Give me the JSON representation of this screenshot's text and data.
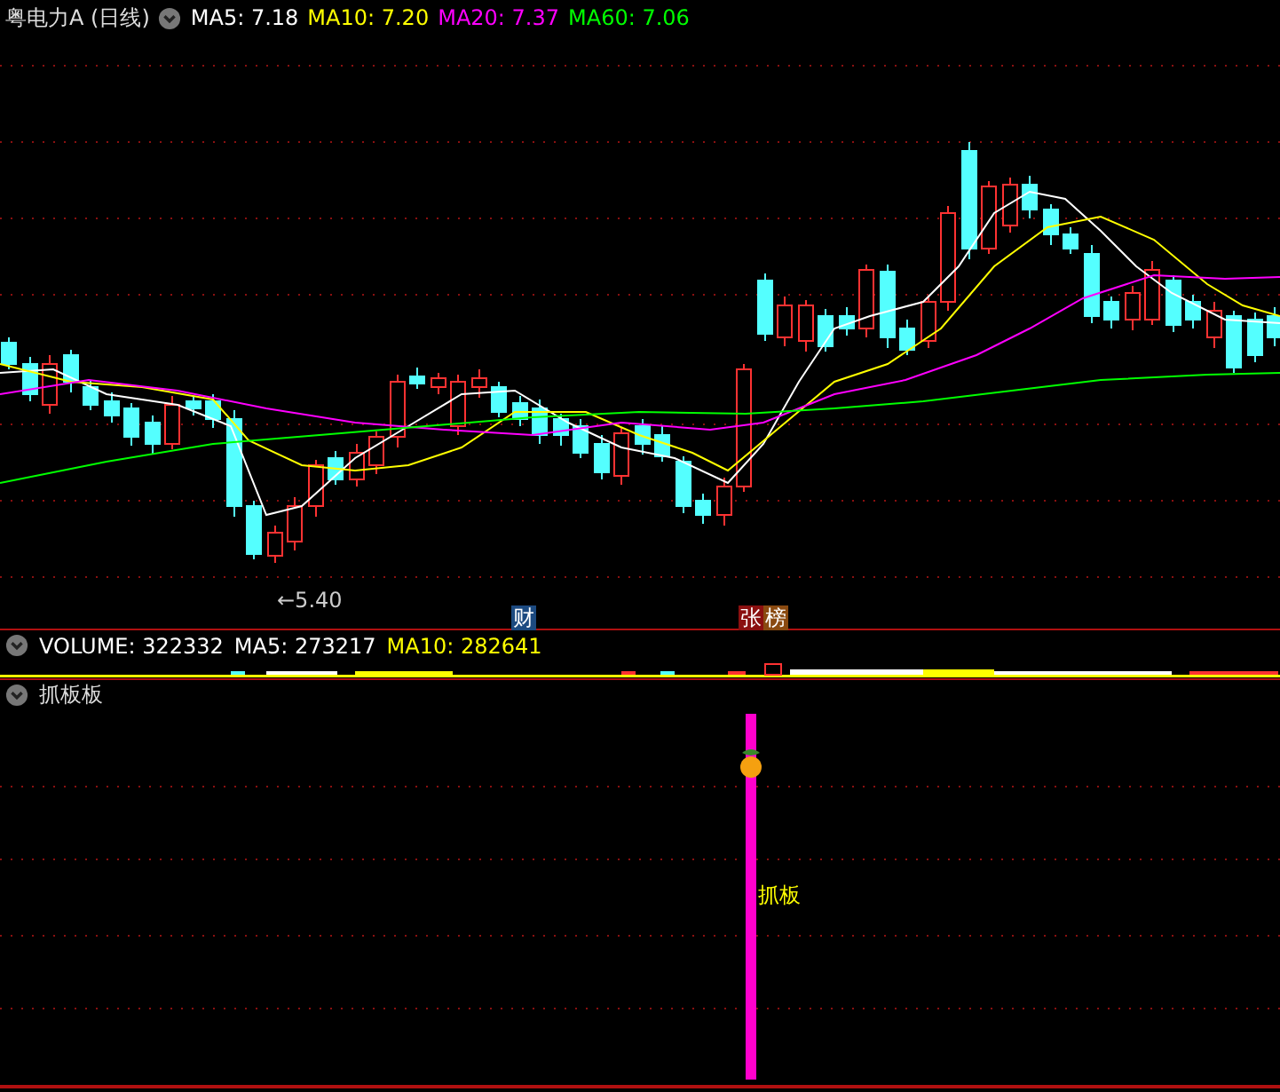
{
  "price_panel": {
    "title": "粤电力A (日线)",
    "indicators": [
      {
        "label": "MA5: 7.18",
        "color": "#ffffff"
      },
      {
        "label": "MA10: 7.20",
        "color": "#ffff00"
      },
      {
        "label": "MA20: 7.37",
        "color": "#ff00ff"
      },
      {
        "label": "MA60: 7.06",
        "color": "#00ff00"
      }
    ],
    "low_label": "←5.40",
    "markers": [
      {
        "text": "财",
        "color": "#1c4a80"
      },
      {
        "text": "张",
        "color": "#8a1010"
      },
      {
        "text": "榜",
        "color": "#8a4a10"
      }
    ]
  },
  "volume_panel": {
    "indicators": [
      {
        "label": "VOLUME: 322332",
        "color": "#ffffff"
      },
      {
        "label": "MA5: 273217",
        "color": "#ffffff"
      },
      {
        "label": "MA10: 282641",
        "color": "#ffff00"
      }
    ]
  },
  "indicator_panel": {
    "title": "抓板板",
    "signal_label": "抓板"
  }
}
